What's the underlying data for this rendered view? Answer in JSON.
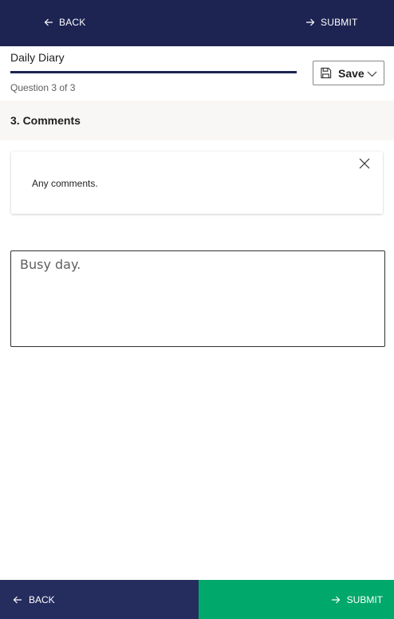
{
  "header": {
    "back_label": "BACK",
    "submit_label": "SUBMIT"
  },
  "form": {
    "title": "Daily Diary",
    "progress_fraction": 1.0,
    "question_count": "Question 3 of 3",
    "save_label": "Save"
  },
  "section": {
    "title": "3. Comments"
  },
  "prompt_card": {
    "text": "Any comments."
  },
  "answer": {
    "value": "Busy day."
  },
  "footer": {
    "back_label": "BACK",
    "submit_label": "SUBMIT"
  },
  "colors": {
    "header_bg": "#1d2452",
    "footer_back_bg": "#252c5e",
    "footer_submit_bg": "#00a86b"
  },
  "icons": {
    "back": "arrow-left-icon",
    "submit": "arrow-right-icon",
    "save": "floppy-disk-icon",
    "save_dropdown": "chevron-down-icon",
    "dismiss": "close-icon"
  }
}
